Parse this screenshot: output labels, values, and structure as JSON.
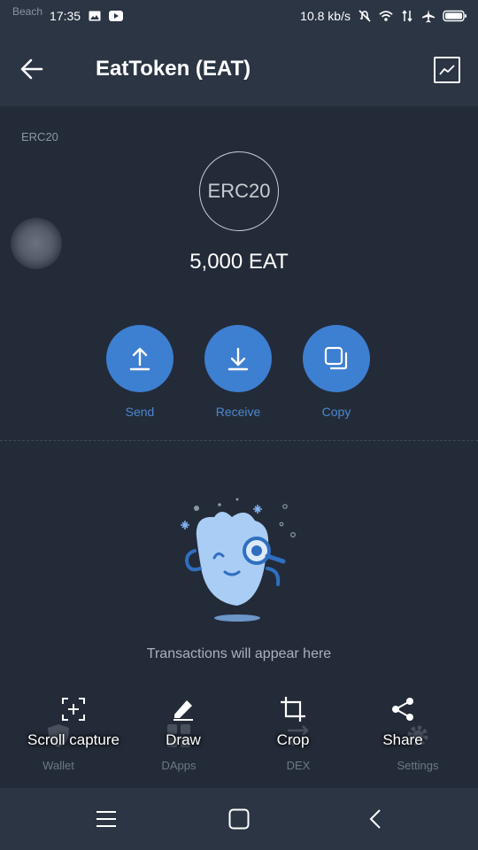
{
  "status_bar": {
    "carrier": "Beach",
    "time": "17:35",
    "speed": "10.8 kb/s",
    "icons": [
      "image-icon",
      "youtube-icon",
      "mute-icon",
      "wifi-icon",
      "data-arrows-icon",
      "airplane-icon",
      "battery-icon"
    ]
  },
  "app_bar": {
    "title": "EatToken (EAT)",
    "back_icon": "arrow-left-icon",
    "chart_icon": "chart-icon"
  },
  "token": {
    "standard": "ERC20",
    "logo_text": "ERC20",
    "balance": "5,000 EAT"
  },
  "actions": [
    {
      "label": "Send",
      "icon": "upload-icon"
    },
    {
      "label": "Receive",
      "icon": "download-icon"
    },
    {
      "label": "Copy",
      "icon": "copy-icon"
    }
  ],
  "empty_state": {
    "message": "Transactions will appear here"
  },
  "bottom_tabs": [
    {
      "label": "Wallet",
      "icon": "shield-icon"
    },
    {
      "label": "DApps",
      "icon": "grid-icon"
    },
    {
      "label": "DEX",
      "icon": "swap-icon"
    },
    {
      "label": "Settings",
      "icon": "gear-icon"
    }
  ],
  "screenshot_overlay": [
    {
      "label": "Scroll capture",
      "icon": "scroll-capture-icon"
    },
    {
      "label": "Draw",
      "icon": "pen-icon"
    },
    {
      "label": "Crop",
      "icon": "crop-icon"
    },
    {
      "label": "Share",
      "icon": "share-icon"
    }
  ],
  "colors": {
    "accent": "#3d7fd1",
    "background": "#232b38",
    "bar": "#2b3544"
  }
}
